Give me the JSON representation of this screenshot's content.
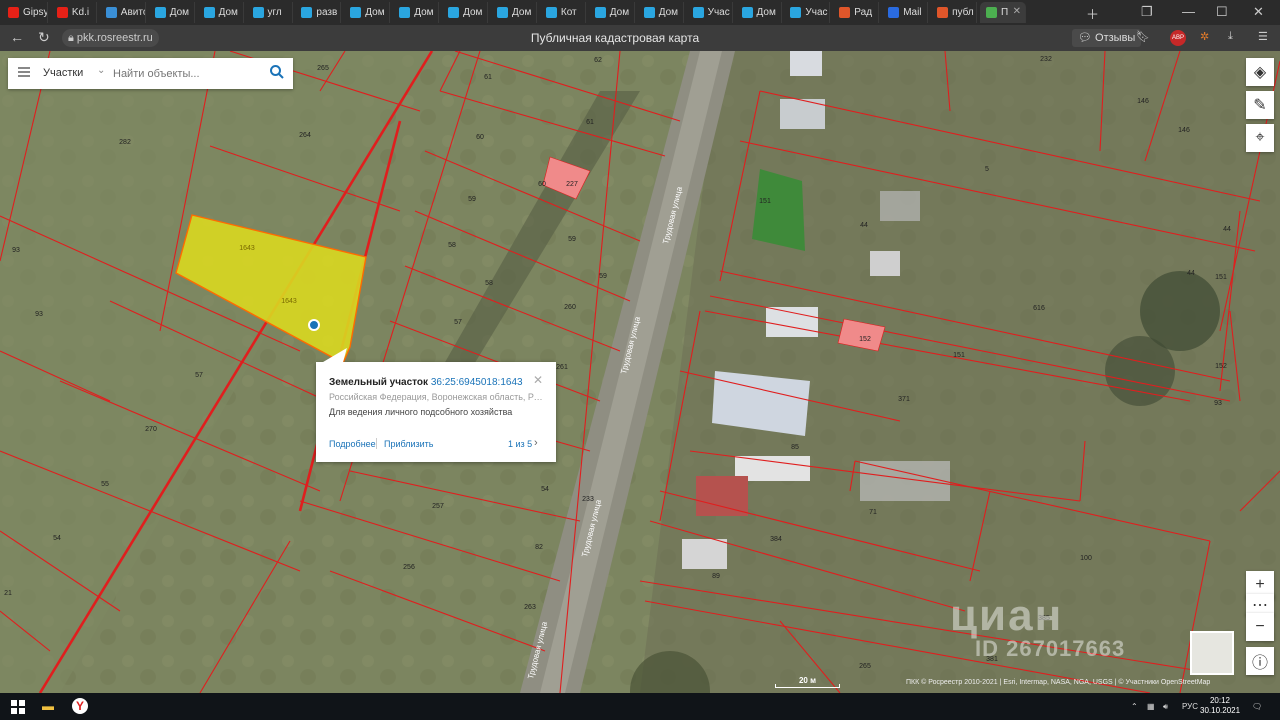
{
  "browser": {
    "tabs": [
      {
        "label": "Gipsy",
        "color": "#e62117"
      },
      {
        "label": "Kd.i",
        "color": "#e62117"
      },
      {
        "label": "Авито",
        "color": "#3a8fd6"
      },
      {
        "label": "Дом",
        "color": "#2aa6e0"
      },
      {
        "label": "Дом",
        "color": "#2aa6e0"
      },
      {
        "label": "угл",
        "color": "#2aa6e0"
      },
      {
        "label": "разв",
        "color": "#2aa6e0"
      },
      {
        "label": "Дом",
        "color": "#2aa6e0"
      },
      {
        "label": "Дом",
        "color": "#2aa6e0"
      },
      {
        "label": "Дом",
        "color": "#2aa6e0"
      },
      {
        "label": "Дом",
        "color": "#2aa6e0"
      },
      {
        "label": "Кот",
        "color": "#2aa6e0"
      },
      {
        "label": "Дом",
        "color": "#2aa6e0"
      },
      {
        "label": "Дом",
        "color": "#2aa6e0"
      },
      {
        "label": "Учас",
        "color": "#2aa6e0"
      },
      {
        "label": "Дом",
        "color": "#2aa6e0"
      },
      {
        "label": "Учас",
        "color": "#2aa6e0"
      },
      {
        "label": "Рад",
        "color": "#e0562a"
      },
      {
        "label": "Mail",
        "color": "#2a6be0"
      },
      {
        "label": "публ",
        "color": "#e0562a"
      },
      {
        "label": "П",
        "color": "#4caf50"
      }
    ],
    "url": "pkk.rosreestr.ru",
    "page_title": "Публичная кадастровая карта",
    "reviews_label": "Отзывы",
    "abp_label": "ABP"
  },
  "search": {
    "layer": "Участки",
    "placeholder": "Найти объекты..."
  },
  "popup": {
    "title": "Земельный участок",
    "cadastral": "36:25:6945018:1643",
    "address": "Российская Федерация, Воронежская область, Рамо...",
    "usage": "Для ведения личного подсобного хозяйства",
    "more": "Подробнее",
    "zoom": "Приблизить",
    "pager": "1 из 5"
  },
  "map": {
    "plot_labels": [
      "265",
      "61",
      "62",
      "282",
      "264",
      "60",
      "61",
      "227",
      "60",
      "59",
      "93",
      "1643",
      "1643",
      "58",
      "59",
      "59",
      "58",
      "93",
      "57",
      "260",
      "57",
      "261",
      "270",
      "55",
      "54",
      "257",
      "54",
      "82",
      "256",
      "21",
      "263",
      "233",
      "232",
      "146",
      "146",
      "44",
      "5",
      "151",
      "44",
      "44",
      "44",
      "151",
      "616",
      "152",
      "151",
      "152",
      "93",
      "371",
      "85",
      "71",
      "384",
      "89",
      "100",
      "385",
      "381",
      "265"
    ],
    "street_labels": [
      "Трудовая улица",
      "Трудовая улица",
      "Трудовая улица",
      "Трудовая улица"
    ],
    "scale_label": "20 м",
    "attribution": "ПКК © Росреестр 2010-2021 | Esri, Intermap, NASA, NGA, USGS | © Участники OpenStreetMap",
    "watermark_brand": "циан",
    "watermark_id": "ID 267017663"
  },
  "taskbar": {
    "time": "20:12",
    "date": "30.10.2021",
    "lang": "РУС"
  }
}
